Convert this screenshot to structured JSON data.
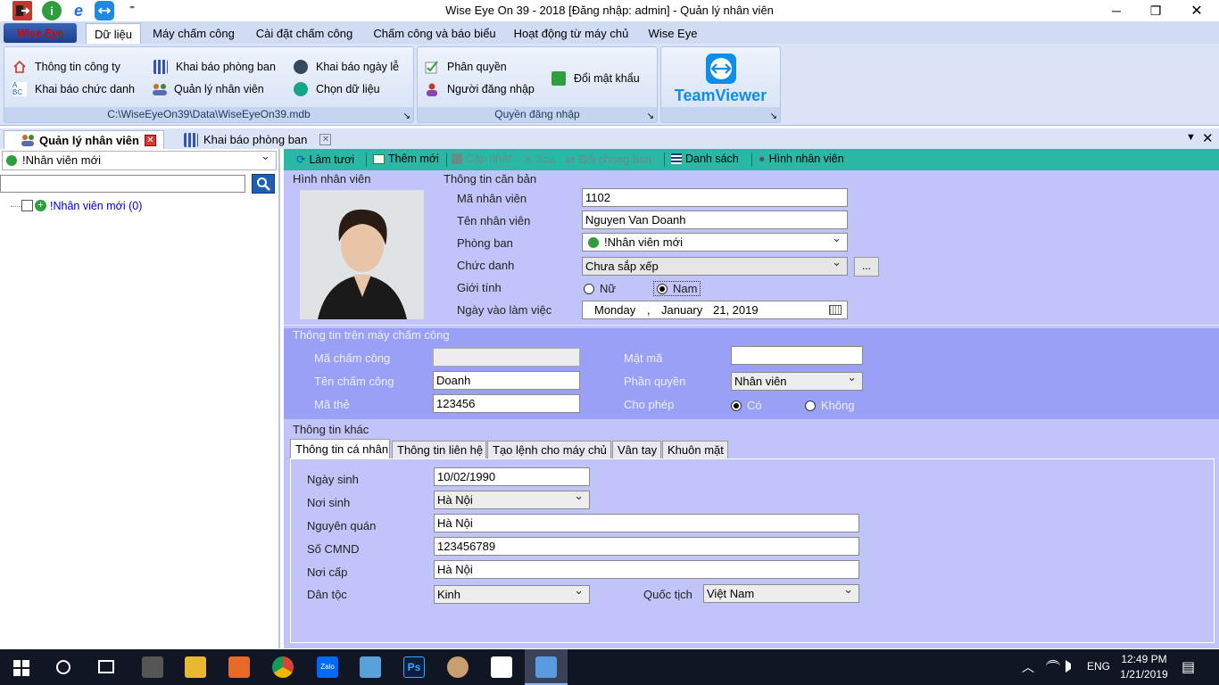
{
  "window": {
    "title": "Wise Eye On 39 - 2018 [Đăng nhập: admin] - Quản lý nhân viên",
    "min": "─",
    "max": "❐",
    "close": "✕"
  },
  "quick_access": {
    "info_glyph": "i",
    "dropdown_glyph": "⁼"
  },
  "app_button": {
    "label": "Wise Eye"
  },
  "menu_tabs": [
    "Dữ liệu",
    "Máy chấm công",
    "Cài đặt chấm công",
    "Chấm công và báo biểu",
    "Hoạt động từ máy chủ",
    "Wise Eye"
  ],
  "ribbon": {
    "data_group": {
      "items": [
        "Thông tin công ty",
        "Khai báo chức danh",
        "Khai báo phòng ban",
        "Quản lý nhân viên",
        "Khai báo ngày lễ",
        "Chọn dữ liệu"
      ],
      "label": "C:\\WiseEyeOn39\\Data\\WiseEyeOn39.mdb"
    },
    "login_group": {
      "items": [
        "Phân quyền",
        "Người đăng nhập",
        "Đổi mật khẩu"
      ],
      "label": "Quyền đăng nhập"
    },
    "teamviewer": {
      "label": "TeamViewer"
    },
    "launcher_glyph": "↘"
  },
  "doc_tabs": [
    {
      "label": "Quản lý nhân viên",
      "close": "✕"
    },
    {
      "label": "Khai báo phòng ban",
      "close": "✕"
    }
  ],
  "panel_controls": {
    "dropdown": "▼",
    "close": "✕"
  },
  "left": {
    "department": "!Nhân viên mới",
    "search_value": "",
    "tree_item": "!Nhân viên mới (0)"
  },
  "toolbar": {
    "refresh": "Làm tươi",
    "add": "Thêm mới",
    "update": "Cập nhật",
    "delete": "Xóa",
    "change_dept": "Đổi phòng ban",
    "list": "Danh sách",
    "photo": "Hình nhân viên"
  },
  "basic": {
    "photo_title": "Hình nhân viên",
    "title": "Thông tin căn bản",
    "emp_id_label": "Mã nhân viên",
    "emp_id": "1102",
    "name_label": "Tên nhân viên",
    "name": "Nguyen Van Doanh",
    "dept_label": "Phòng ban",
    "dept": "!Nhân viên mới",
    "position_label": "Chức danh",
    "position": "Chưa sắp xếp",
    "browse": "...",
    "gender_label": "Giới tính",
    "female": "Nữ",
    "male": "Nam",
    "start_label": "Ngày vào làm việc",
    "start_weekday": "Monday",
    "start_sep": ",",
    "start_month": "January",
    "start_date": "21, 2019"
  },
  "machine": {
    "title": "Thông tin trên máy chấm công",
    "code_label": "Mã chấm công",
    "code": "",
    "timename_label": "Tên chấm công",
    "timename": "Doanh",
    "card_label": "Mã thẻ",
    "card": "123456",
    "pwd_label": "Mật mã",
    "pwd": "",
    "role_label": "Phần quyền",
    "role": "Nhân viên",
    "allow_label": "Cho phép",
    "yes": "Có",
    "no": "Không"
  },
  "other": {
    "title": "Thông tin khác",
    "tabs": [
      "Thông tin cá nhân",
      "Thông tin liên hệ",
      "Tạo lệnh cho máy chủ",
      "Vân tay",
      "Khuôn mặt"
    ],
    "dob_label": "Ngày sinh",
    "dob": "10/02/1990",
    "pob_label": "Nơi sinh",
    "pob": "Hà Nội",
    "origin_label": "Nguyên quán",
    "origin": "Hà Nội",
    "id_label": "Số CMND",
    "id_no": "123456789",
    "issue_label": "Nơi cấp",
    "issue": "Hà Nội",
    "ethnic_label": "Dân tộc",
    "ethnic": "Kinh",
    "nation_label": "Quốc tịch",
    "nation": "Việt Nam"
  },
  "taskbar": {
    "lang": "ENG",
    "time": "12:49 PM",
    "date": "1/21/2019",
    "ps_label": "Ps",
    "zalo_label": "Zalo",
    "notif_glyph": "▤"
  },
  "colors": {
    "toolbar": "#2ab8a6",
    "panel": "#c1c4f8",
    "machine_band": "#9aa0f5",
    "accent": "#0000cc"
  }
}
